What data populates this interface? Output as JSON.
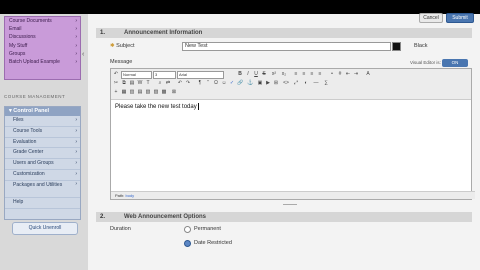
{
  "header": {
    "cancel_label": "Cancel",
    "submit_label": "Submit"
  },
  "sidebar": {
    "menu_items": [
      {
        "label": "Course Documents"
      },
      {
        "label": "Email"
      },
      {
        "label": "Discussions"
      },
      {
        "label": "My Stuff"
      },
      {
        "label": "Groups"
      },
      {
        "label": "Batch Upload Example"
      }
    ],
    "course_management_label": "COURSE MANAGEMENT",
    "control_panel": {
      "title": "Control Panel",
      "items": [
        {
          "label": "Files"
        },
        {
          "label": "Course Tools"
        },
        {
          "label": "Evaluation"
        },
        {
          "label": "Grade Center"
        },
        {
          "label": "Users and Groups"
        },
        {
          "label": "Customization"
        },
        {
          "label": "Packages and Utilities"
        },
        {
          "label": "Help"
        }
      ]
    },
    "quick_unenroll_label": "Quick Unenroll"
  },
  "section1": {
    "number": "1.",
    "title": "Announcement Information",
    "subject_label": "Subject",
    "subject_value": "New Test",
    "color_label": "Black",
    "color_value": "#111111",
    "message_label": "Message",
    "visual_editor_label": "Visual Editor is:",
    "visual_editor_state": "ON",
    "toolbar": {
      "format_select": "Normal",
      "size_select": "3",
      "font_select": "Arial"
    },
    "body_text": "Please take the new test today",
    "path_label": "Path:",
    "path_value": "body"
  },
  "section2": {
    "number": "2.",
    "title": "Web Announcement Options",
    "duration_label": "Duration",
    "option_permanent": "Permanent",
    "option_date_restricted": "Date Restricted",
    "selected": "Date Restricted"
  }
}
